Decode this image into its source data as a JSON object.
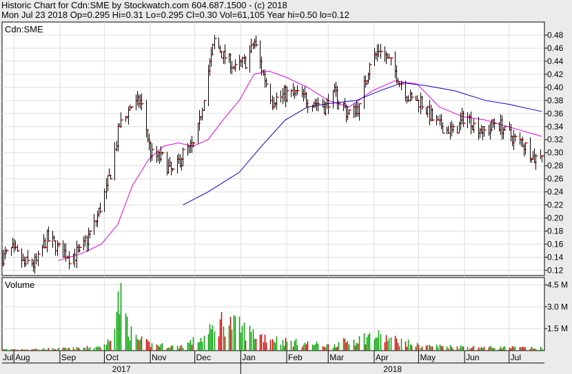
{
  "header": {
    "line1": "Historic Chart for Cdn:SME by Stockwatch.com 604.687.1500 - (c) 2018",
    "line2": "Mon Jul 23 2018  Op=0.295  Hi=0.31  Lo=0.295  Cl=0.30  Vol=61,105  Year hi=0.50  lo=0.12"
  },
  "colors": {
    "price_bar": "#000000",
    "close_tick": "#cc0000",
    "ma_short": "#e000e0",
    "ma_long": "#0000cc",
    "vol_up": "#00a000",
    "vol_down": "#d00000"
  },
  "chart_data": [
    {
      "type": "line",
      "title": "Cdn:SME",
      "chart_style": "ohlc",
      "y_axis_side": "right",
      "yticks": [
        "0.12",
        "0.14",
        "0.16",
        "0.18",
        "0.20",
        "0.22",
        "0.24",
        "0.26",
        "0.28",
        "0.30",
        "0.32",
        "0.34",
        "0.36",
        "0.38",
        "0.40",
        "0.42",
        "0.44",
        "0.46",
        "0.48"
      ],
      "ylim": [
        0.112,
        0.5
      ],
      "x_months": [
        "Jul",
        "Aug",
        "Sep",
        "Oct",
        "Nov",
        "Dec",
        "Jan",
        "Feb",
        "Mar",
        "Apr",
        "May",
        "Jun",
        "Jul"
      ],
      "x_years": [
        "2017",
        "2018"
      ],
      "x_range": [
        "2017-07-24",
        "2018-07-23"
      ],
      "price_anchors": [
        {
          "date": "2017-07-24",
          "close": 0.14
        },
        {
          "date": "2017-07-31",
          "close": 0.15
        },
        {
          "date": "2017-08-08",
          "close": 0.13
        },
        {
          "date": "2017-08-16",
          "close": 0.13
        },
        {
          "date": "2017-08-23",
          "close": 0.17
        },
        {
          "date": "2017-09-01",
          "close": 0.15
        },
        {
          "date": "2017-09-08",
          "close": 0.14
        },
        {
          "date": "2017-09-15",
          "close": 0.15
        },
        {
          "date": "2017-09-22",
          "close": 0.18
        },
        {
          "date": "2017-09-29",
          "close": 0.22
        },
        {
          "date": "2017-10-05",
          "close": 0.27
        },
        {
          "date": "2017-10-11",
          "close": 0.34
        },
        {
          "date": "2017-10-18",
          "close": 0.37
        },
        {
          "date": "2017-10-25",
          "close": 0.38
        },
        {
          "date": "2017-11-01",
          "close": 0.3
        },
        {
          "date": "2017-11-09",
          "close": 0.29
        },
        {
          "date": "2017-11-16",
          "close": 0.27
        },
        {
          "date": "2017-11-23",
          "close": 0.3
        },
        {
          "date": "2017-12-01",
          "close": 0.31
        },
        {
          "date": "2017-12-08",
          "close": 0.4
        },
        {
          "date": "2017-12-14",
          "close": 0.47
        },
        {
          "date": "2017-12-20",
          "close": 0.45
        },
        {
          "date": "2017-12-28",
          "close": 0.43
        },
        {
          "date": "2018-01-05",
          "close": 0.44
        },
        {
          "date": "2018-01-10",
          "close": 0.47
        },
        {
          "date": "2018-01-16",
          "close": 0.42
        },
        {
          "date": "2018-01-22",
          "close": 0.38
        },
        {
          "date": "2018-01-30",
          "close": 0.39
        },
        {
          "date": "2018-02-08",
          "close": 0.39
        },
        {
          "date": "2018-02-16",
          "close": 0.38
        },
        {
          "date": "2018-02-26",
          "close": 0.37
        },
        {
          "date": "2018-03-05",
          "close": 0.39
        },
        {
          "date": "2018-03-14",
          "close": 0.36
        },
        {
          "date": "2018-03-22",
          "close": 0.37
        },
        {
          "date": "2018-03-29",
          "close": 0.44
        },
        {
          "date": "2018-04-05",
          "close": 0.46
        },
        {
          "date": "2018-04-11",
          "close": 0.44
        },
        {
          "date": "2018-04-18",
          "close": 0.41
        },
        {
          "date": "2018-04-25",
          "close": 0.38
        },
        {
          "date": "2018-05-02",
          "close": 0.38
        },
        {
          "date": "2018-05-10",
          "close": 0.35
        },
        {
          "date": "2018-05-17",
          "close": 0.34
        },
        {
          "date": "2018-05-25",
          "close": 0.33
        },
        {
          "date": "2018-06-01",
          "close": 0.36
        },
        {
          "date": "2018-06-08",
          "close": 0.34
        },
        {
          "date": "2018-06-15",
          "close": 0.33
        },
        {
          "date": "2018-06-22",
          "close": 0.35
        },
        {
          "date": "2018-06-29",
          "close": 0.33
        },
        {
          "date": "2018-07-06",
          "close": 0.32
        },
        {
          "date": "2018-07-13",
          "close": 0.31
        },
        {
          "date": "2018-07-18",
          "close": 0.29
        },
        {
          "date": "2018-07-23",
          "close": 0.3
        }
      ],
      "series": [
        {
          "values_note": "",
          "points": [
            {
              "date": "2017-08-31",
              "value": 0.135
            },
            {
              "date": "2017-09-15",
              "value": 0.145
            },
            {
              "date": "2017-09-29",
              "value": 0.16
            },
            {
              "date": "2017-10-10",
              "value": 0.19
            },
            {
              "date": "2017-10-20",
              "value": 0.25
            },
            {
              "date": "2017-10-31",
              "value": 0.29
            },
            {
              "date": "2017-11-10",
              "value": 0.31
            },
            {
              "date": "2017-11-20",
              "value": 0.315
            },
            {
              "date": "2017-11-30",
              "value": 0.31
            },
            {
              "date": "2017-12-10",
              "value": 0.32
            },
            {
              "date": "2017-12-20",
              "value": 0.35
            },
            {
              "date": "2017-12-31",
              "value": 0.38
            },
            {
              "date": "2018-01-10",
              "value": 0.42
            },
            {
              "date": "2018-01-20",
              "value": 0.425
            },
            {
              "date": "2018-02-01",
              "value": 0.415
            },
            {
              "date": "2018-02-15",
              "value": 0.4
            },
            {
              "date": "2018-03-01",
              "value": 0.38
            },
            {
              "date": "2018-03-15",
              "value": 0.37
            },
            {
              "date": "2018-03-31",
              "value": 0.395
            },
            {
              "date": "2018-04-15",
              "value": 0.41
            },
            {
              "date": "2018-04-30",
              "value": 0.405
            },
            {
              "date": "2018-05-15",
              "value": 0.37
            },
            {
              "date": "2018-05-31",
              "value": 0.355
            },
            {
              "date": "2018-06-15",
              "value": 0.35
            },
            {
              "date": "2018-06-30",
              "value": 0.34
            },
            {
              "date": "2018-07-23",
              "value": 0.325
            }
          ]
        },
        {
          "values_note": "",
          "points": [
            {
              "date": "2017-11-23",
              "value": 0.22
            },
            {
              "date": "2017-12-10",
              "value": 0.24
            },
            {
              "date": "2017-12-31",
              "value": 0.27
            },
            {
              "date": "2018-01-15",
              "value": 0.31
            },
            {
              "date": "2018-01-31",
              "value": 0.35
            },
            {
              "date": "2018-02-15",
              "value": 0.37
            },
            {
              "date": "2018-03-01",
              "value": 0.375
            },
            {
              "date": "2018-03-20",
              "value": 0.38
            },
            {
              "date": "2018-04-05",
              "value": 0.395
            },
            {
              "date": "2018-04-20",
              "value": 0.407
            },
            {
              "date": "2018-05-05",
              "value": 0.403
            },
            {
              "date": "2018-05-25",
              "value": 0.395
            },
            {
              "date": "2018-06-15",
              "value": 0.38
            },
            {
              "date": "2018-07-01",
              "value": 0.374
            },
            {
              "date": "2018-07-23",
              "value": 0.363
            }
          ]
        }
      ]
    },
    {
      "type": "bar",
      "title": "Volume",
      "yticks": [
        "1.5 M",
        "3.0 M",
        "4.5 M"
      ],
      "ylim": [
        0,
        5000000
      ],
      "volume_anchors": [
        {
          "date": "2017-07-24",
          "value": 100000
        },
        {
          "date": "2017-08-15",
          "value": 120000
        },
        {
          "date": "2017-09-15",
          "value": 200000
        },
        {
          "date": "2017-10-02",
          "value": 400000
        },
        {
          "date": "2017-10-11",
          "value": 4100000
        },
        {
          "date": "2017-10-20",
          "value": 1000000
        },
        {
          "date": "2017-11-01",
          "value": 500000
        },
        {
          "date": "2017-11-20",
          "value": 300000
        },
        {
          "date": "2017-12-08",
          "value": 1100000
        },
        {
          "date": "2017-12-20",
          "value": 2400000
        },
        {
          "date": "2018-01-10",
          "value": 1300000
        },
        {
          "date": "2018-02-01",
          "value": 700000
        },
        {
          "date": "2018-03-01",
          "value": 400000
        },
        {
          "date": "2018-04-01",
          "value": 1200000
        },
        {
          "date": "2018-05-01",
          "value": 400000
        },
        {
          "date": "2018-06-01",
          "value": 300000
        },
        {
          "date": "2018-07-23",
          "value": 200000
        }
      ]
    }
  ]
}
